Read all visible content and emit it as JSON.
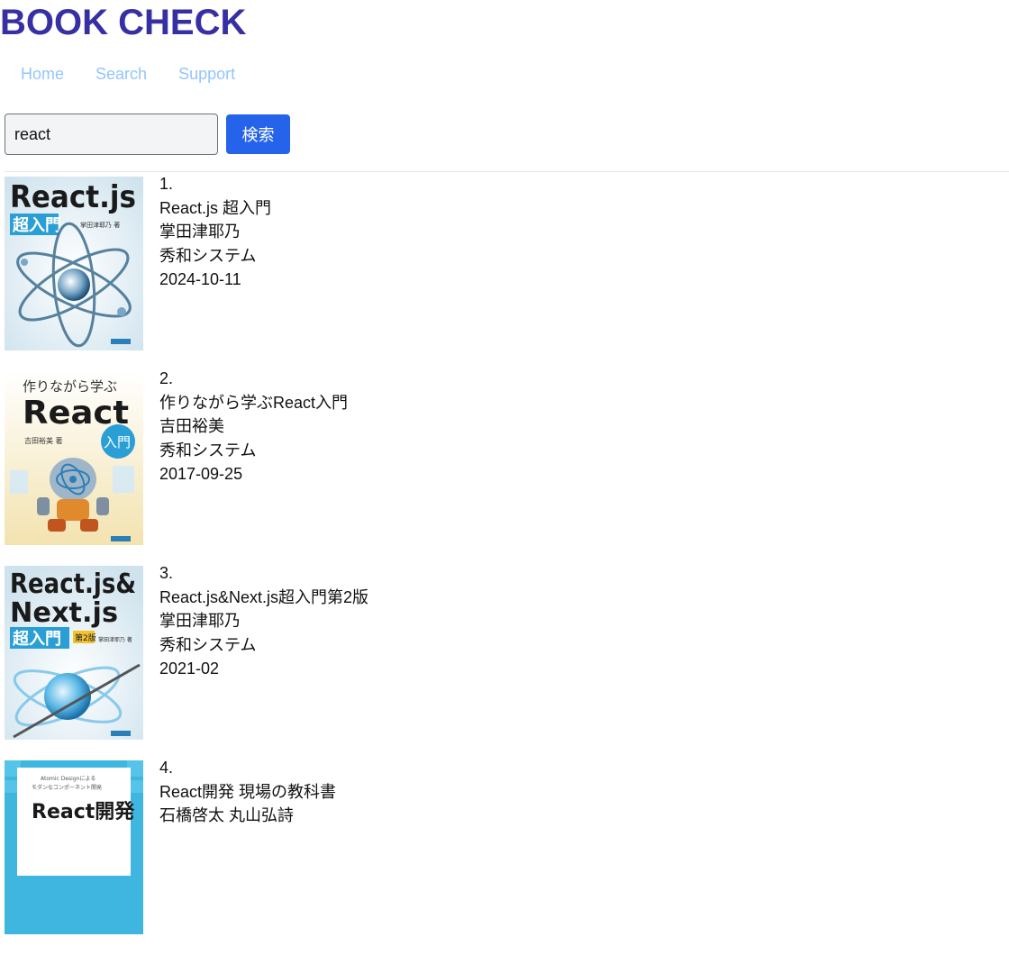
{
  "header": {
    "site_title": "BOOK CHECK"
  },
  "nav": {
    "items": [
      "Home",
      "Search",
      "Support"
    ]
  },
  "search": {
    "query": "react",
    "button_label": "検索"
  },
  "colors": {
    "title": "#3730a3",
    "nav_link": "#93c5fd",
    "button": "#2563eb",
    "input_bg": "#f3f4f6"
  },
  "results": [
    {
      "index": "1.",
      "title": "React.js 超入門",
      "author": "掌田津耶乃",
      "publisher": "秀和システム",
      "date": "2024-10-11",
      "cover": {
        "main": "React.js",
        "sub": "超入門",
        "author_small": "掌田津耶乃 著",
        "theme": "atom-blue"
      }
    },
    {
      "index": "2.",
      "title": "作りながら学ぶReact入門",
      "author": "吉田裕美",
      "publisher": "秀和システム",
      "date": "2017-09-25",
      "cover": {
        "top": "作りながら学ぶ",
        "main": "React",
        "badge": "入門",
        "author_small": "吉田裕美 著",
        "theme": "robot-yellow"
      }
    },
    {
      "index": "3.",
      "title": "React.js&Next.js超入門第2版",
      "author": "掌田津耶乃",
      "publisher": "秀和システム",
      "date": "2021-02",
      "cover": {
        "main": "React.js&",
        "main2": "Next.js",
        "sub": "超入門",
        "edition": "第2版",
        "author_small": "掌田津耶乃 著",
        "theme": "atom-blue"
      }
    },
    {
      "index": "4.",
      "title": "React開発 現場の教科書",
      "author": "石橋啓太 丸山弘詩",
      "publisher": "",
      "date": "",
      "cover": {
        "top": "Atomic Designによる",
        "top2": "モダンなコンポーネント開発",
        "main": "React開発",
        "theme": "cyan-tiles"
      }
    }
  ]
}
